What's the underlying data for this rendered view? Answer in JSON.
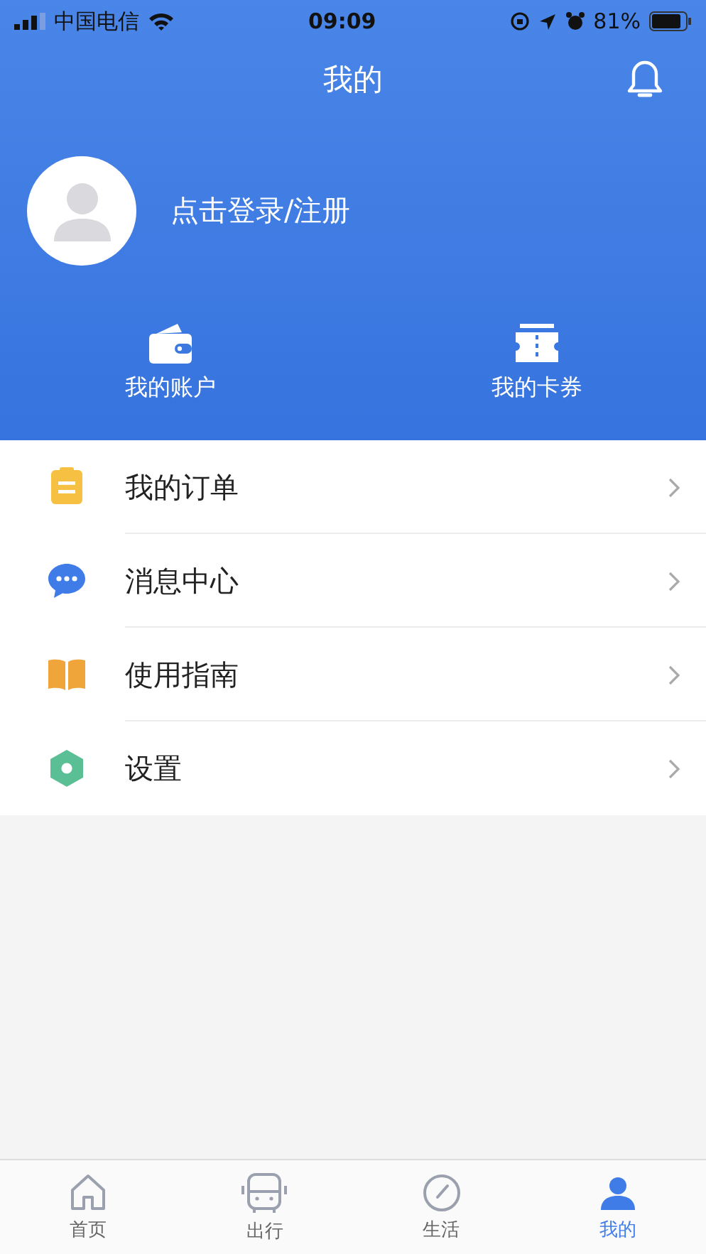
{
  "status_bar": {
    "carrier": "中国电信",
    "time": "09:09",
    "battery": "81%"
  },
  "header": {
    "title": "我的"
  },
  "profile": {
    "login_text": "点击登录/注册"
  },
  "shortcuts": [
    {
      "kind": "wallet",
      "label": "我的账户"
    },
    {
      "kind": "ticket",
      "label": "我的卡券"
    }
  ],
  "menu": [
    {
      "kind": "order",
      "label": "我的订单"
    },
    {
      "kind": "message",
      "label": "消息中心"
    },
    {
      "kind": "guide",
      "label": "使用指南"
    },
    {
      "kind": "settings",
      "label": "设置"
    }
  ],
  "tab_bar": [
    {
      "kind": "home",
      "label": "首页",
      "selected": false
    },
    {
      "kind": "travel",
      "label": "出行",
      "selected": false
    },
    {
      "kind": "life",
      "label": "生活",
      "selected": false
    },
    {
      "kind": "mine",
      "label": "我的",
      "selected": true
    }
  ]
}
